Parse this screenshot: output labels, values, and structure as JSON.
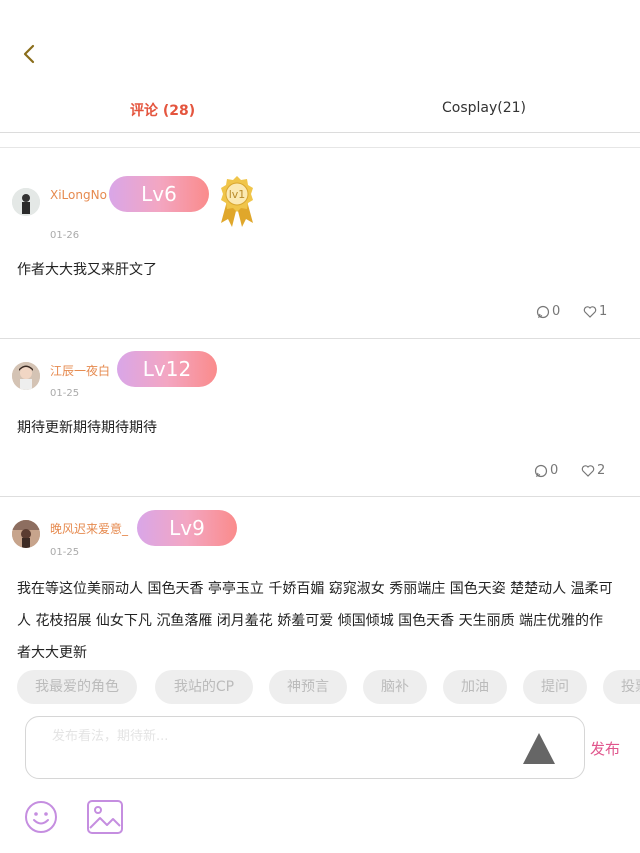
{
  "nav": {
    "back_icon": "chevron-left-icon"
  },
  "tabs": [
    {
      "label": "评论 (28)",
      "active": true
    },
    {
      "label": "Cosplay(21)",
      "active": false
    }
  ],
  "comments": [
    {
      "username": "XiLongNo",
      "level": "Lv6",
      "medal": "lv1",
      "date": "01-26",
      "text": "作者大大我又来肝文了",
      "reply_count": "0",
      "like_count": "1"
    },
    {
      "username": "江辰一夜白",
      "level": "Lv12",
      "date": "01-25",
      "text": "期待更新期待期待期待",
      "reply_count": "0",
      "like_count": "2"
    },
    {
      "username": "晚风迟来爱意_",
      "level": "Lv9",
      "date": "01-25",
      "text_lines": [
        "我在等这位美丽动人 国色天香 亭亭玉立 千娇百媚 窈窕淑女 秀丽端庄 国色天姿 楚楚动人 温柔可",
        "人 花枝招展 仙女下凡 沉鱼落雁 闭月羞花 娇羞可爱 倾国倾城 国色天香 天生丽质 端庄优雅的作",
        "者大大更新"
      ]
    }
  ],
  "quick_tags": [
    "我最爱的角色",
    "我站的CP",
    "神预言",
    "脑补",
    "加油",
    "提问",
    "投票"
  ],
  "composer": {
    "placeholder": "发布看法，期待新...",
    "publish_label": "发布"
  },
  "colors": {
    "accent": "#e4553e",
    "username": "#e68a4f",
    "publish": "#e0558c",
    "icon_purple": "#c58ee0"
  }
}
